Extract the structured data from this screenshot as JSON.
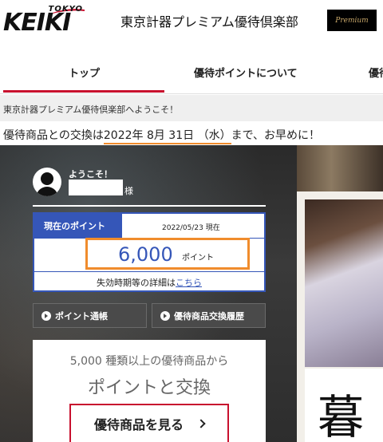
{
  "header": {
    "logo_tokyo": "TOKYO",
    "logo_keiki": "KEIKI",
    "site_title": "東京計器プレミアム優待倶楽部",
    "badge": "Premium"
  },
  "nav": {
    "items": [
      {
        "label": "トップ"
      },
      {
        "label": "優待ポイントについて"
      },
      {
        "label": "優待"
      }
    ]
  },
  "welcome_bar": {
    "text": "東京計器プレミアム優待倶楽部へようこそ！"
  },
  "notice": {
    "before": "優待商品との交換は",
    "date": "2022年 8月 31日 （水）",
    "after": "まで、お早めに！"
  },
  "member": {
    "greeting": "ようこそ！",
    "honorific": "様"
  },
  "points": {
    "label": "現在のポイント",
    "as_of": "2022/05/23 現在",
    "value": "6,000",
    "unit": "ポイント",
    "expiry_text": "失効時期等の詳細は",
    "expiry_link": "こちら"
  },
  "buttons": {
    "point_statement": "ポイント通帳",
    "exchange_history": "優待商品交換履歴"
  },
  "exchange": {
    "sub": "5,000 種類以上の優待商品から",
    "main": "ポイントと交換",
    "cta": "優待商品を見る"
  },
  "hero": {
    "kanji": "暮"
  },
  "colors": {
    "accent_red": "#c8102e",
    "points_blue": "#3556b8",
    "highlight_orange": "#f08c2c"
  }
}
